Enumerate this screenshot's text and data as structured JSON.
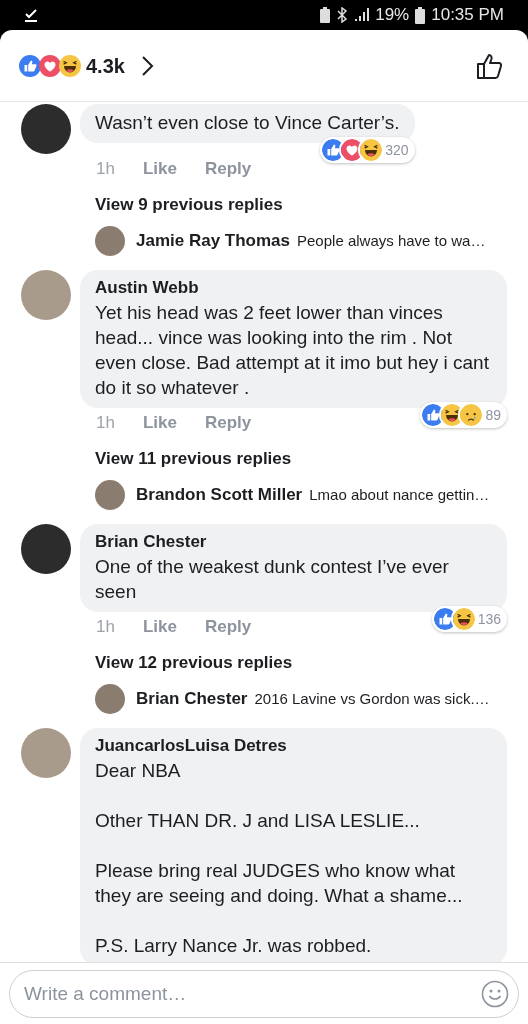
{
  "status_bar": {
    "battery": "19%",
    "time": "10:35 PM"
  },
  "header": {
    "reactions": [
      {
        "kind": "like"
      },
      {
        "kind": "love"
      },
      {
        "kind": "haha"
      }
    ],
    "count": "4.3k"
  },
  "comments": [
    {
      "text": "Wasn’t even close to Vince Carter’s.",
      "time": "1h",
      "like": "Like",
      "reply": "Reply",
      "reactions": [
        {
          "kind": "like"
        },
        {
          "kind": "love"
        },
        {
          "kind": "haha"
        }
      ],
      "reaction_count": "320",
      "replies_link": "View 9 previous replies",
      "reply_preview": {
        "author": "Jamie Ray Thomas",
        "text": "People always have to wa…"
      }
    },
    {
      "author": "Austin Webb",
      "text": "Yet his head was 2 feet lower than vinces head... vince was looking into the rim . Not even close.  Bad attempt at it imo but hey i cant do it so whatever .",
      "time": "1h",
      "like": "Like",
      "reply": "Reply",
      "reactions": [
        {
          "kind": "like"
        },
        {
          "kind": "haha"
        },
        {
          "kind": "sad"
        }
      ],
      "reaction_count": "89",
      "replies_link": "View 11 previous replies",
      "reply_preview": {
        "author": "Brandon Scott Miller",
        "text": "Lmao about nance gettin…"
      }
    },
    {
      "author": "Brian Chester",
      "text": "One of the weakest dunk contest I’ve ever seen",
      "time": "1h",
      "like": "Like",
      "reply": "Reply",
      "reactions": [
        {
          "kind": "like"
        },
        {
          "kind": "haha"
        }
      ],
      "reaction_count": "136",
      "replies_link": "View 12 previous replies",
      "reply_preview": {
        "author": "Brian Chester",
        "text": "2016 Lavine vs Gordon was sick.…"
      }
    },
    {
      "author": "JuancarlosLuisa Detres",
      "text": "Dear NBA\n\nOther THAN DR. J and LISA LESLIE...\n\nPlease bring real JUDGES who know what they are seeing and doing. What a shame...\n\nP.S. Larry Nance Jr. was robbed."
    }
  ],
  "composer": {
    "placeholder": "Write a comment…"
  }
}
